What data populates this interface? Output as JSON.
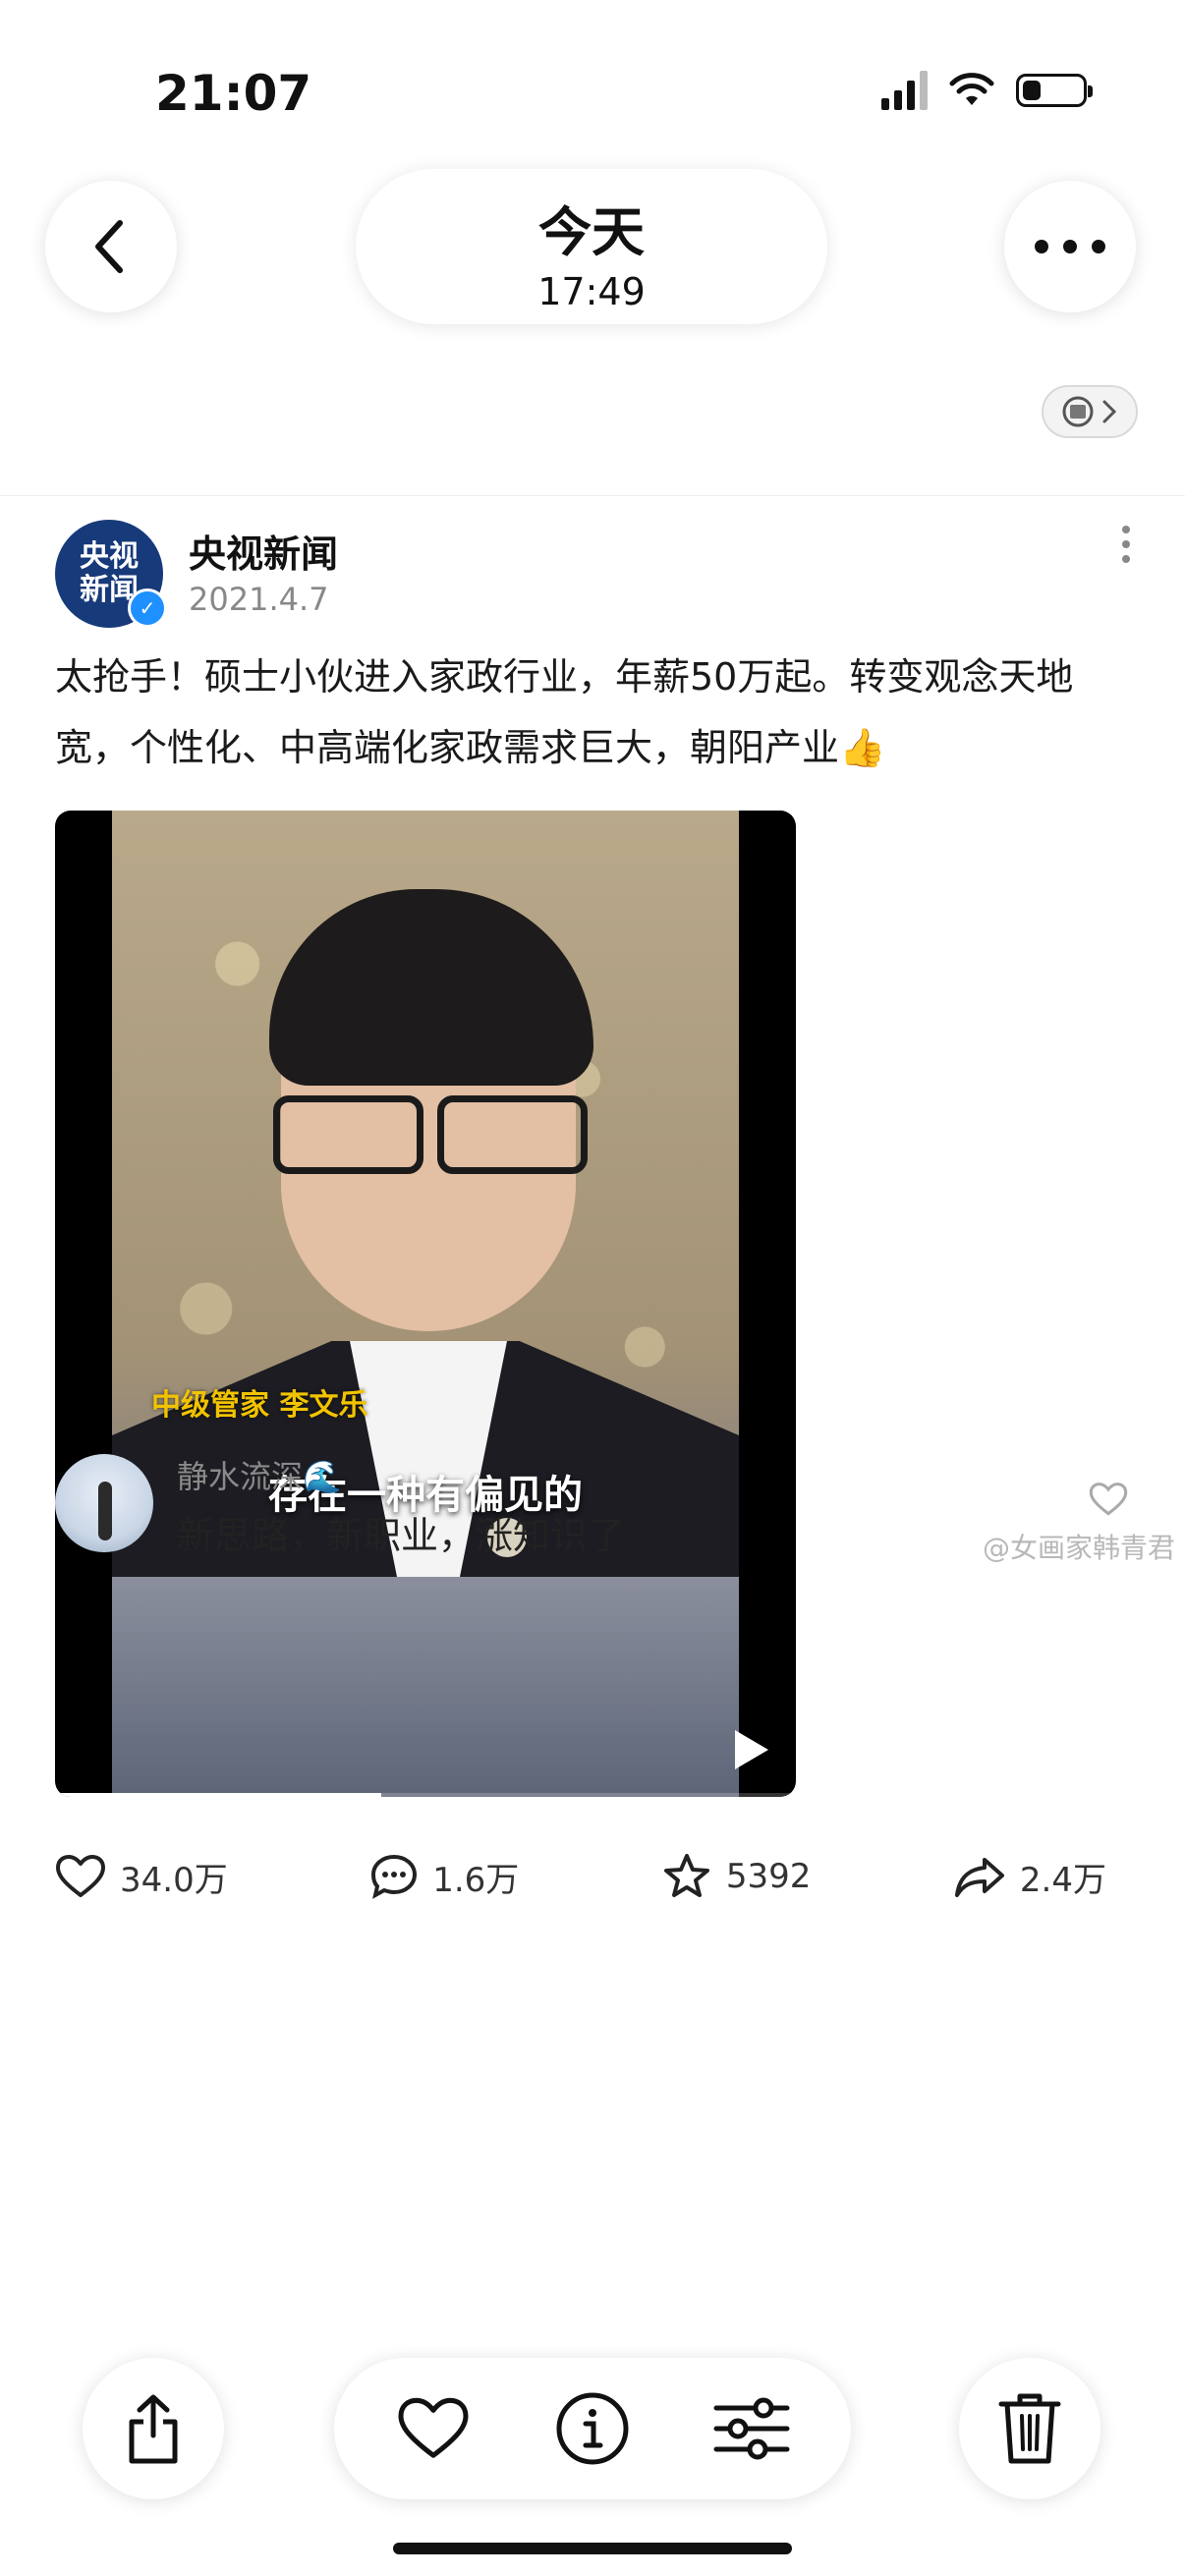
{
  "status_bar": {
    "time": "21:07"
  },
  "header": {
    "title": "今天",
    "subtitle": "17:49"
  },
  "post": {
    "author": "央视新闻",
    "avatar_text_top": "央视",
    "avatar_text_bottom": "新闻",
    "date": "2021.4.7",
    "text": "太抢手！硕士小伙进入家政行业，年薪50万起。转变观念天地宽，个性化、中高端化家政需求巨大，朝阳产业👍",
    "video": {
      "caption_name": "中级管家 李文乐",
      "caption_line": "存在一种有偏见的",
      "progress": 0.44
    },
    "actions": {
      "likes": "34.0万",
      "comments": "1.6万",
      "favorites": "5392",
      "shares": "2.4万"
    }
  },
  "comment": {
    "user": "静水流深🌊",
    "text": "新思路，新职业，涨知识了"
  },
  "watermark": "@女画家韩青君",
  "colors": {
    "accent_blue": "#1e90ff",
    "caption_yellow": "#f2c300",
    "avatar_blue": "#173a7a"
  },
  "icons": [
    "back-icon",
    "more-icon",
    "live-photo-icon",
    "heart-icon",
    "comment-icon",
    "star-icon",
    "share-arrow-icon",
    "share-icon",
    "info-icon",
    "adjust-icon",
    "trash-icon"
  ]
}
